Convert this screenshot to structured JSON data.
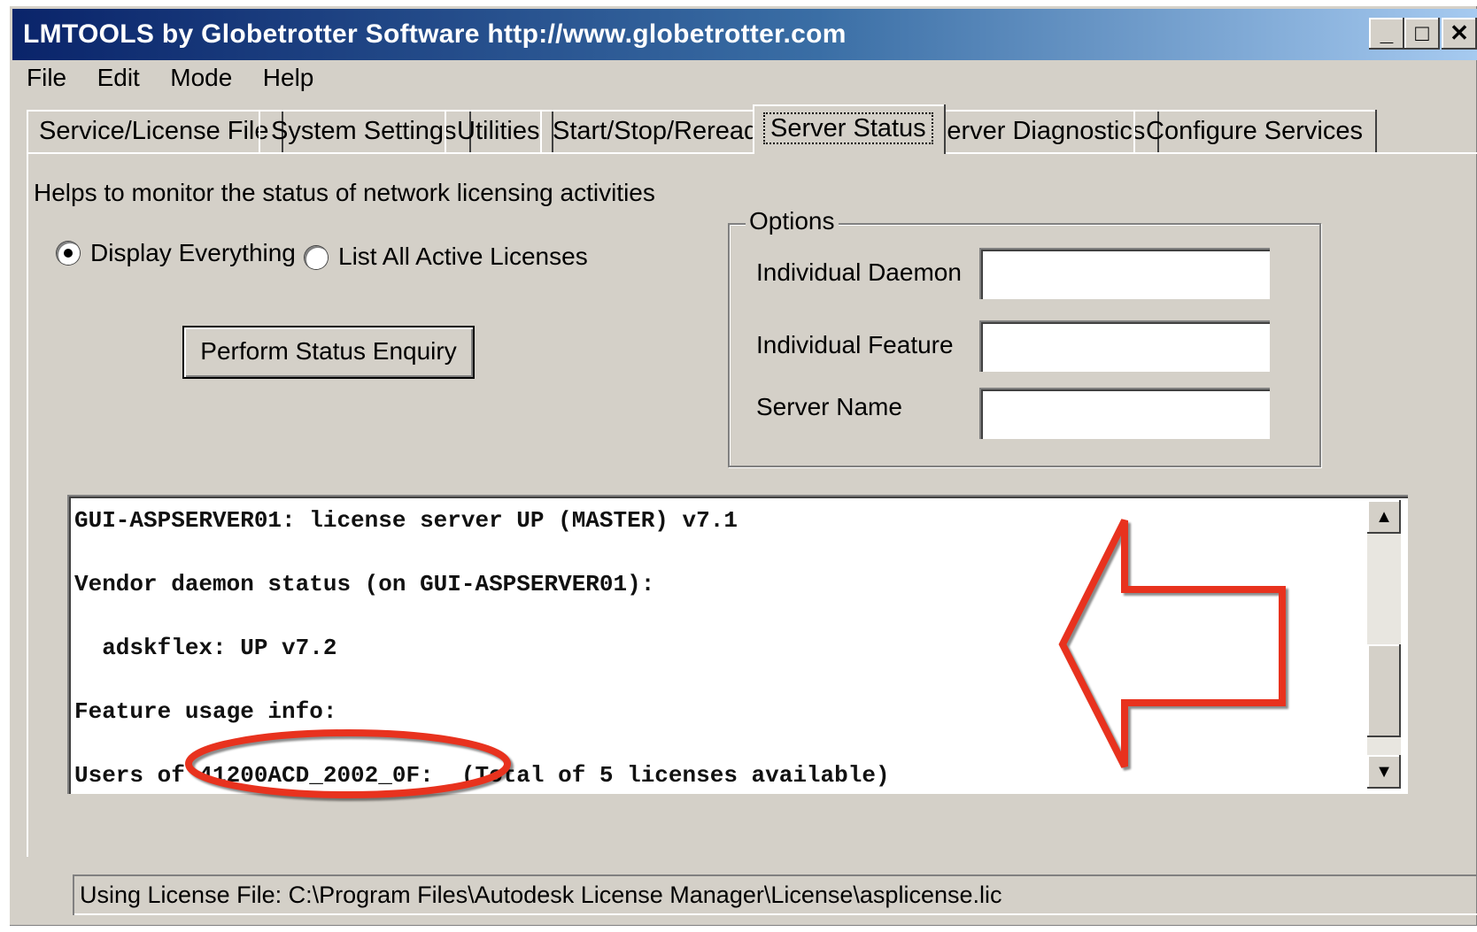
{
  "window": {
    "title": "LMTOOLS by Globetrotter Software http://www.globetrotter.com",
    "minimize": "_",
    "maximize": "□",
    "close": "✕"
  },
  "menu": [
    "File",
    "Edit",
    "Mode",
    "Help"
  ],
  "tabs": [
    {
      "label": "Service/License File"
    },
    {
      "label": "System Settings"
    },
    {
      "label": "Utilities"
    },
    {
      "label": "Start/Stop/Reread"
    },
    {
      "label": "Server Status",
      "active": true
    },
    {
      "label": "Server Diagnostics"
    },
    {
      "label": "Configure Services"
    }
  ],
  "panel": {
    "description": "Helps to monitor the status of network licensing activities",
    "radio_display_everything": "Display Everything",
    "radio_list_active": "List All Active Licenses",
    "selected_radio": "Display Everything",
    "perform_button": "Perform Status Enquiry",
    "options": {
      "legend": "Options",
      "individual_daemon_label": "Individual Daemon",
      "individual_daemon_value": "",
      "individual_feature_label": "Individual Feature",
      "individual_feature_value": "",
      "server_name_label": "Server Name",
      "server_name_value": ""
    },
    "output_lines": [
      "GUI-ASPSERVER01: license server UP (MASTER) v7.1",
      "Vendor daemon status (on GUI-ASPSERVER01):",
      "  adskflex: UP v7.2",
      "Feature usage info:",
      "Users of 41200ACD_2002_0F:  (Total of 5 licenses available)"
    ]
  },
  "statusbar": {
    "text": "Using License File:  C:\\Program Files\\Autodesk License Manager\\License\\asplicense.lic"
  },
  "annotations": {
    "color": "#e8321e",
    "arrow": "left-pointing arrow",
    "ellipse": "circle highlighting feature code"
  }
}
